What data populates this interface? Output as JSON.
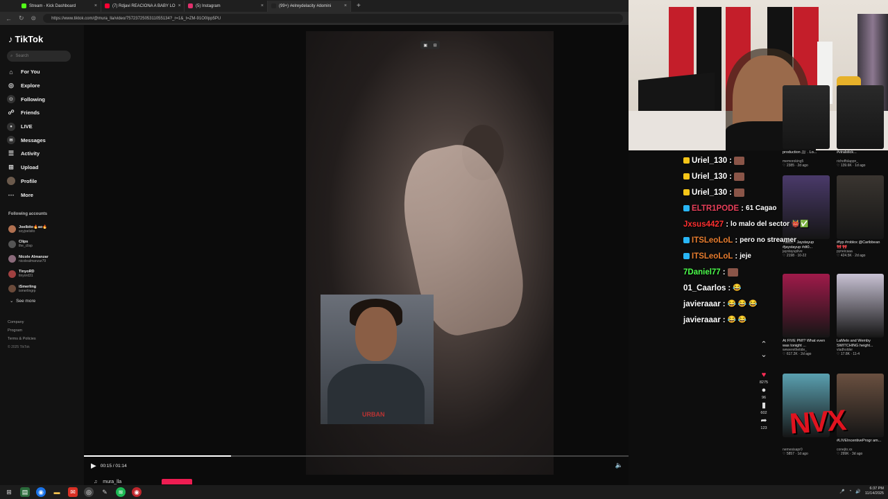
{
  "browser": {
    "tabs": [
      {
        "title": "Stream - Kick Dashboard",
        "color": "#53fc18"
      },
      {
        "title": "(7) Rdjavi REACIONA A BABY LO",
        "color": "#ff0033"
      },
      {
        "title": "(5) Instagram",
        "color": "#e1306c"
      },
      {
        "title": "(99+) #elreydelacity #domini",
        "color": "#222222",
        "active": true
      }
    ],
    "new_tab": "+",
    "url": "https://www.tiktok.com/@mura_lla/video/7572372505311055134?_r=1&_t=ZM-91O0Ipp5PU"
  },
  "tiktok": {
    "logo": "TikTok",
    "search_placeholder": "Search",
    "nav": [
      {
        "label": "For You",
        "icon": "⌂"
      },
      {
        "label": "Explore",
        "icon": "◎"
      },
      {
        "label": "Following",
        "icon": "⚇"
      },
      {
        "label": "Friends",
        "icon": "☍"
      },
      {
        "label": "LIVE",
        "icon": "●"
      },
      {
        "label": "Messages",
        "icon": "✉"
      },
      {
        "label": "Activity",
        "icon": "☰"
      },
      {
        "label": "Upload",
        "icon": "⊞"
      },
      {
        "label": "Profile",
        "icon": ""
      },
      {
        "label": "More",
        "icon": "⋯"
      }
    ],
    "following_title": "Following accounts",
    "accounts": [
      {
        "name": "Joelbito🔥ao🔥",
        "handle": "soyjoelsito"
      },
      {
        "name": "Clips",
        "handle": "the_clisp"
      },
      {
        "name": "Nicole Almanzar",
        "handle": "nicolealmanzar79"
      },
      {
        "name": "TinyoRD",
        "handle": "tinyord31"
      },
      {
        "name": "iSmerling",
        "handle": "ismerlingrp"
      }
    ],
    "see_more": "See more",
    "footer": [
      "Company",
      "Program",
      "Terms & Policies"
    ],
    "copyright": "© 2025 TikTok",
    "player": {
      "time": "00:15 / 01:14",
      "progress": 0.27,
      "author": "mura_lla"
    },
    "facecam_text": "URBAN",
    "actions": {
      "likes": "8275",
      "comments": "96",
      "saves": "602",
      "shares": "123"
    }
  },
  "chat": [
    {
      "user": "Uriel_130",
      "msg": "",
      "color": "#ffffff",
      "badge": "#f5c518",
      "emote": true
    },
    {
      "user": "Uriel_130",
      "msg": "",
      "color": "#ffffff",
      "badge": "#f5c518",
      "emote": true
    },
    {
      "user": "Uriel_130",
      "msg": "",
      "color": "#ffffff",
      "badge": "#f5c518",
      "emote": true
    },
    {
      "user": "ELTR1PODE",
      "msg": "61 Cagao",
      "color": "#e8405a",
      "badge": "#29b6f6"
    },
    {
      "user": "Jxsus4427",
      "msg": "lo malo del sector 👹✅",
      "color": "#ff3030",
      "badge": ""
    },
    {
      "user": "ITSLeoLoL",
      "msg": "pero no streamer",
      "color": "#e87d2f",
      "badge": "#29b6f6"
    },
    {
      "user": "ITSLeoLoL",
      "msg": "jeje",
      "color": "#e87d2f",
      "badge": "#29b6f6"
    },
    {
      "user": "7Daniel77",
      "msg": "",
      "color": "#4cff4c",
      "badge": "",
      "emote": true
    },
    {
      "user": "01_Caarlos",
      "msg": "😂",
      "color": "#ffffff",
      "badge": ""
    },
    {
      "user": "javieraaar",
      "msg": "😂 😂 😂",
      "color": "#ffffff",
      "badge": ""
    },
    {
      "user": "javieraaar",
      "msg": "😂 😂",
      "color": "#ffffff",
      "badge": ""
    }
  ],
  "recommendations": [
    {
      "caption": "production 🎥 . Lo...",
      "user": "memoroking5",
      "likes": "♡ 2385",
      "age": "2d ago",
      "color": "#2a2a2a"
    },
    {
      "caption": "#viralstick...",
      "user": "richoffslappn_",
      "likes": "♡ 139.6K",
      "age": "1d ago",
      "color": "#2a2a2a"
    },
    {
      "caption": "Twitch - Jaystayup #jaystayup #dt0...",
      "user": "jaystayuplive",
      "likes": "♡ 2198",
      "age": "10-22",
      "color": "#4a3a6a"
    },
    {
      "caption": "#fyp #roblox @Caribbean 🎀 🎀",
      "user": "pyneicaaa",
      "likes": "♡ 424.5K",
      "age": "2d ago",
      "color": "#3a3530"
    },
    {
      "caption": "At FIVE PM!? What even was tonight ...",
      "user": "wewerethetide_",
      "likes": "♡ 617.2K",
      "age": "2d ago",
      "color": "#a01a4a"
    },
    {
      "caption": "LaMelo and Wemby SWITCHING height...",
      "user": "vladholder",
      "likes": "♡ 17.8K",
      "age": "11-4",
      "color": "#c8c2d4"
    },
    {
      "caption": "",
      "user": "nemesisapr0",
      "likes": "♡ 5857",
      "age": "1d ago",
      "color": "#5aa0b0"
    },
    {
      "caption": "#LIVEIncentiveProgr am...",
      "user": "conejto.xx",
      "likes": "♡ 299K",
      "age": "3d ago",
      "color": "#6a5040"
    }
  ],
  "overlay_text": "NVX",
  "taskbar": {
    "time": "6:37 PM",
    "date": "11/14/2025"
  }
}
